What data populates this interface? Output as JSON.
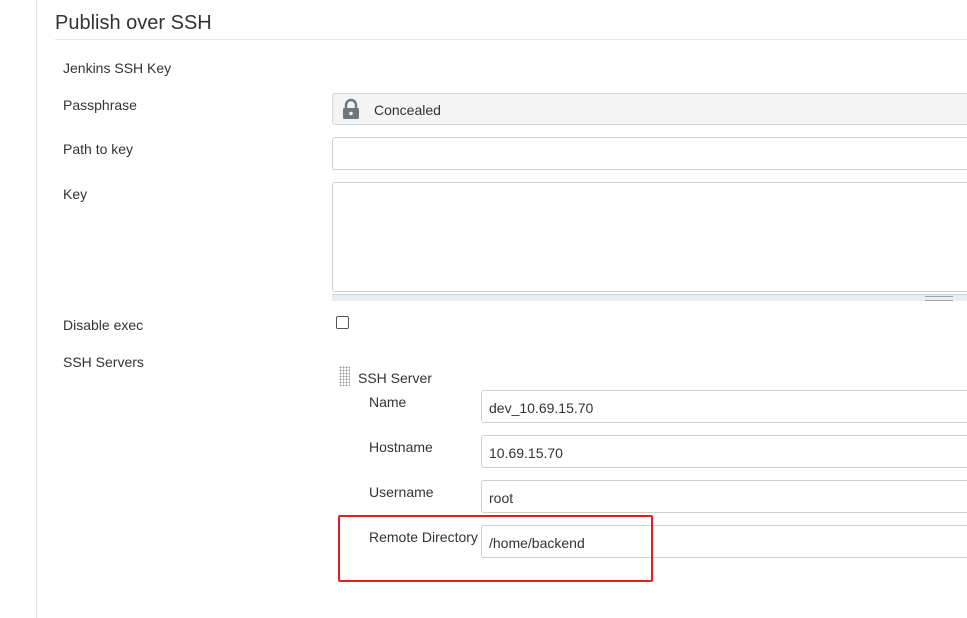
{
  "section": {
    "title": "Publish over SSH"
  },
  "fields": {
    "jenkins_ssh_key": {
      "label": "Jenkins SSH Key"
    },
    "passphrase": {
      "label": "Passphrase",
      "value": "Concealed",
      "icon": "lock-icon"
    },
    "path_to_key": {
      "label": "Path to key",
      "value": ""
    },
    "key": {
      "label": "Key",
      "value": ""
    },
    "disable_exec": {
      "label": "Disable exec",
      "checked": false
    }
  },
  "ssh_servers": {
    "label": "SSH Servers",
    "server": {
      "header": "SSH Server",
      "name": {
        "label": "Name",
        "value": "dev_10.69.15.70"
      },
      "hostname": {
        "label": "Hostname",
        "value": "10.69.15.70"
      },
      "username": {
        "label": "Username",
        "value": "root"
      },
      "remote_directory": {
        "label": "Remote Directory",
        "value": "/home/backend"
      }
    }
  },
  "colors": {
    "highlight": "#e02020",
    "border": "#cfcfcf",
    "concealed_bg": "#f4f4f4"
  }
}
